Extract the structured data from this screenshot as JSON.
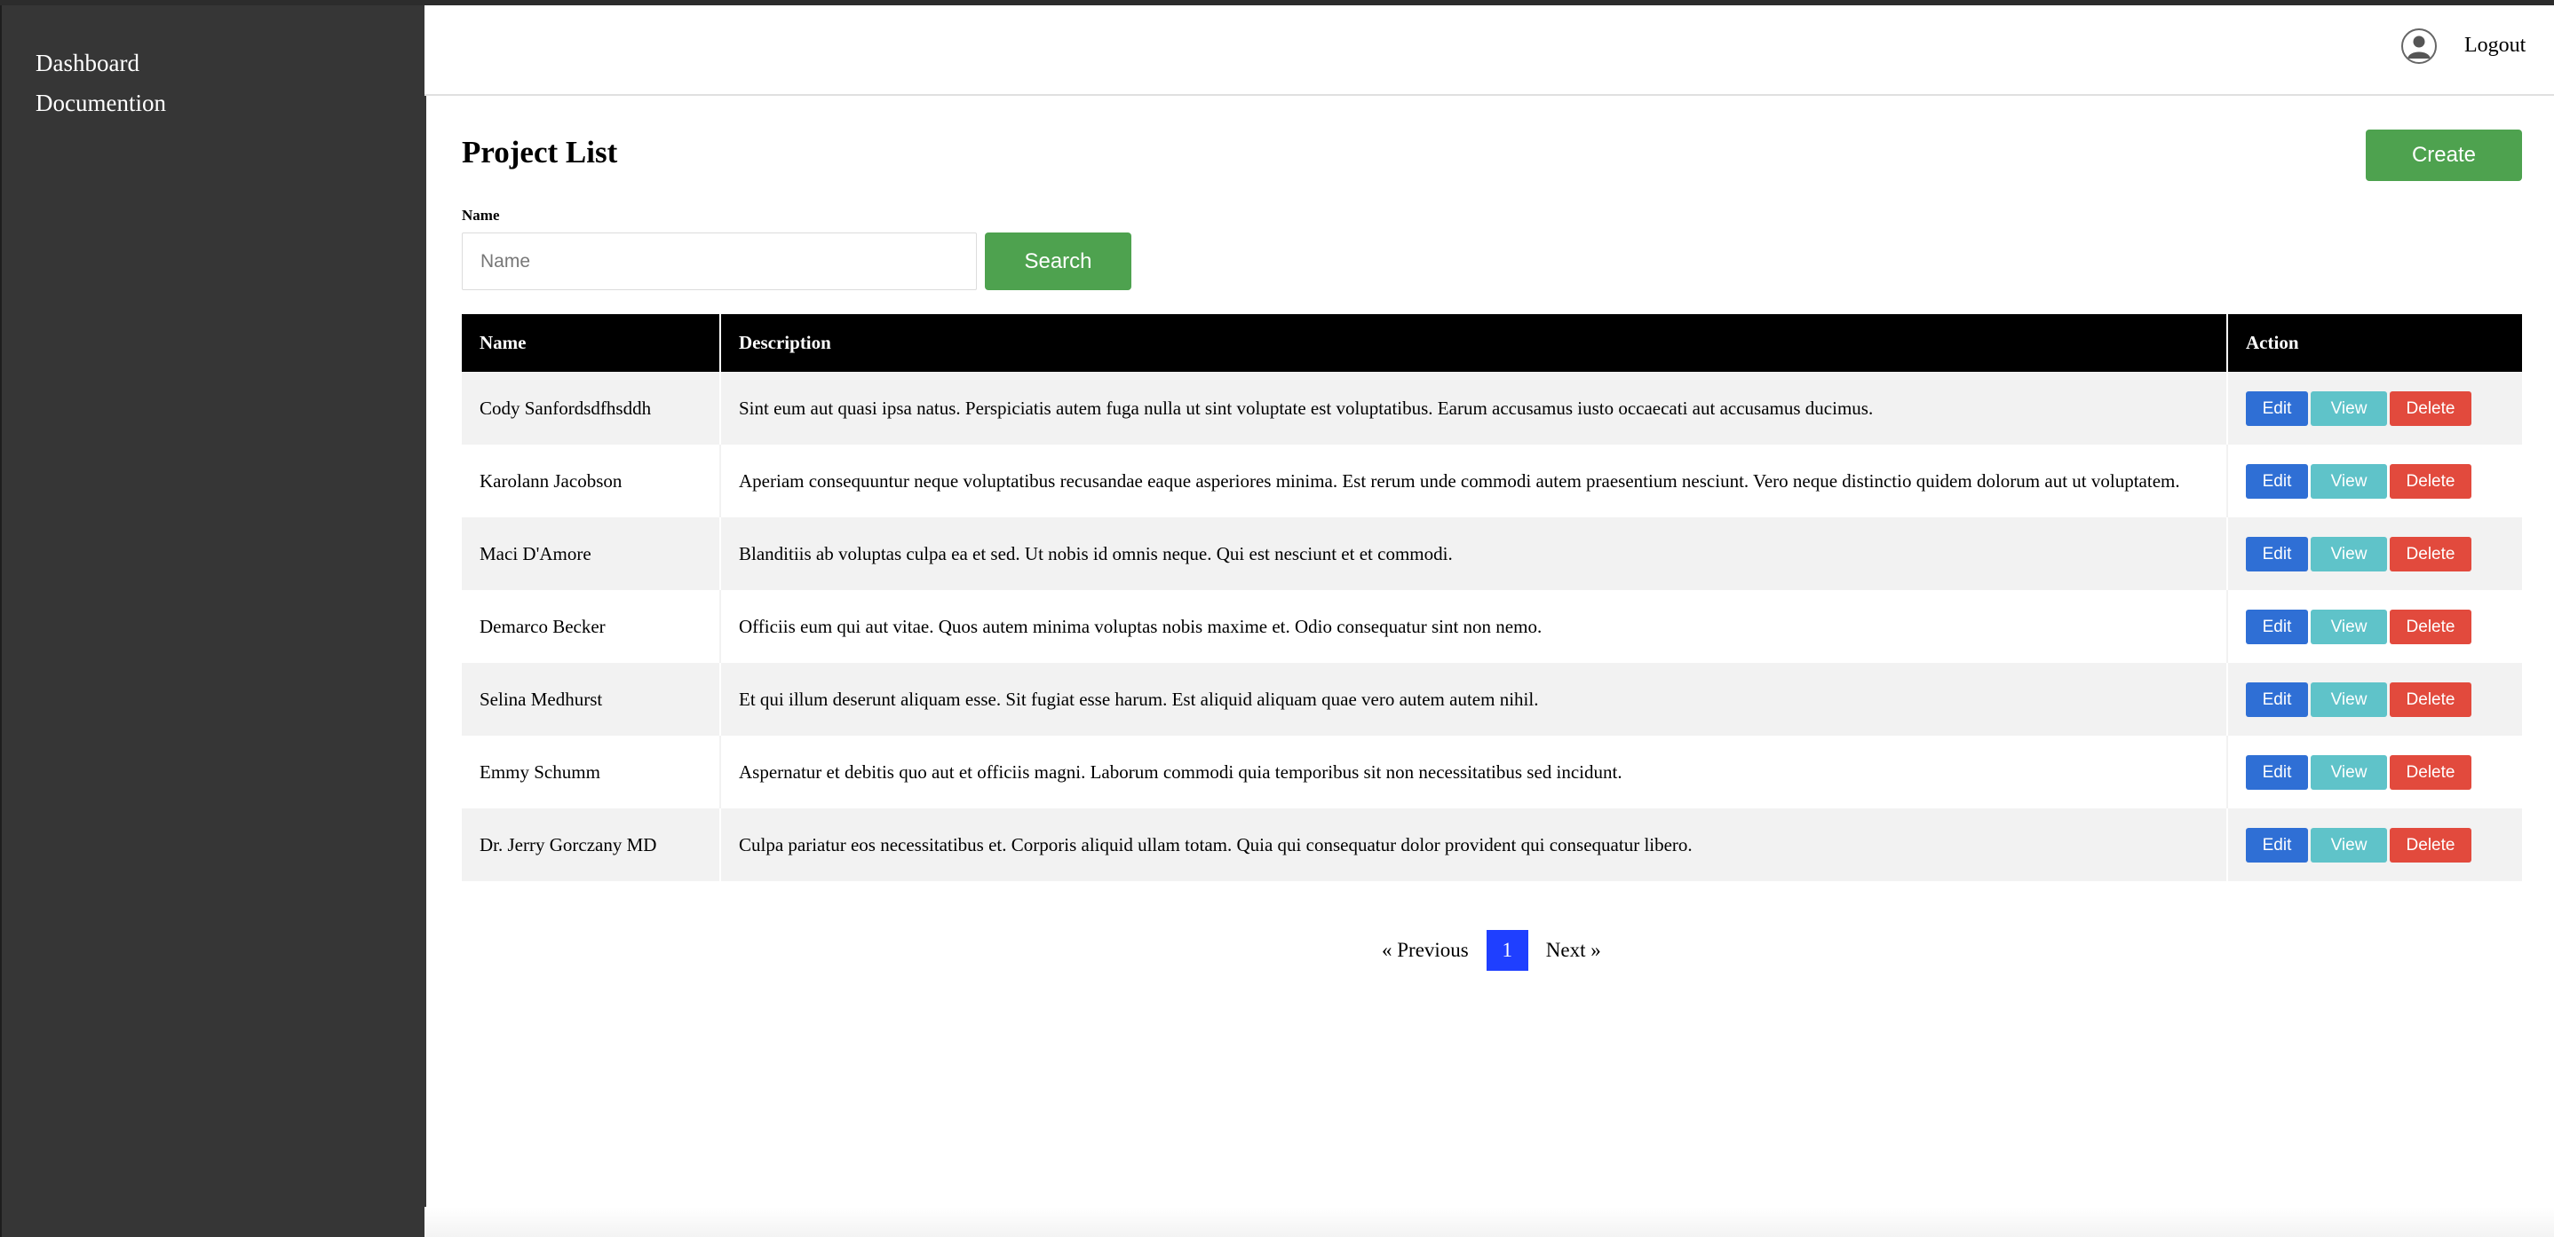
{
  "sidebar": {
    "items": [
      {
        "label": "Dashboard"
      },
      {
        "label": "Documention"
      }
    ]
  },
  "header": {
    "logout_label": "Logout",
    "avatar_icon": "user-avatar-icon"
  },
  "page": {
    "title": "Project List",
    "create_label": "Create"
  },
  "filter": {
    "label": "Name",
    "placeholder": "Name",
    "value": "",
    "search_label": "Search"
  },
  "table": {
    "columns": [
      "Name",
      "Description",
      "Action"
    ],
    "rows": [
      {
        "name": "Cody Sanfordsdfhsddh",
        "description": "Sint eum aut quasi ipsa natus. Perspiciatis autem fuga nulla ut sint voluptate est voluptatibus. Earum accusamus iusto occaecati aut accusamus ducimus."
      },
      {
        "name": "Karolann Jacobson",
        "description": "Aperiam consequuntur neque voluptatibus recusandae eaque asperiores minima. Est rerum unde commodi autem praesentium nesciunt. Vero neque distinctio quidem dolorum aut ut voluptatem."
      },
      {
        "name": "Maci D'Amore",
        "description": "Blanditiis ab voluptas culpa ea et sed. Ut nobis id omnis neque. Qui est nesciunt et et commodi."
      },
      {
        "name": "Demarco Becker",
        "description": "Officiis eum qui aut vitae. Quos autem minima voluptas nobis maxime et. Odio consequatur sint non nemo."
      },
      {
        "name": "Selina Medhurst",
        "description": "Et qui illum deserunt aliquam esse. Sit fugiat esse harum. Est aliquid aliquam quae vero autem autem nihil."
      },
      {
        "name": "Emmy Schumm",
        "description": "Aspernatur et debitis quo aut et officiis magni. Laborum commodi quia temporibus sit non necessitatibus sed incidunt."
      },
      {
        "name": "Dr. Jerry Gorczany MD",
        "description": "Culpa pariatur eos necessitatibus et. Corporis aliquid ullam totam. Quia qui consequatur dolor provident qui consequatur libero."
      }
    ],
    "actions": {
      "edit": "Edit",
      "view": "View",
      "delete": "Delete"
    }
  },
  "pagination": {
    "previous_label": "« Previous",
    "current_page": "1",
    "next_label": "Next »"
  },
  "colors": {
    "sidebar_bg": "#363636",
    "success": "#4ea24f",
    "edit": "#2f6fd5",
    "view": "#5fc3c9",
    "delete": "#e24a3d",
    "active_page": "#1f3fff"
  }
}
